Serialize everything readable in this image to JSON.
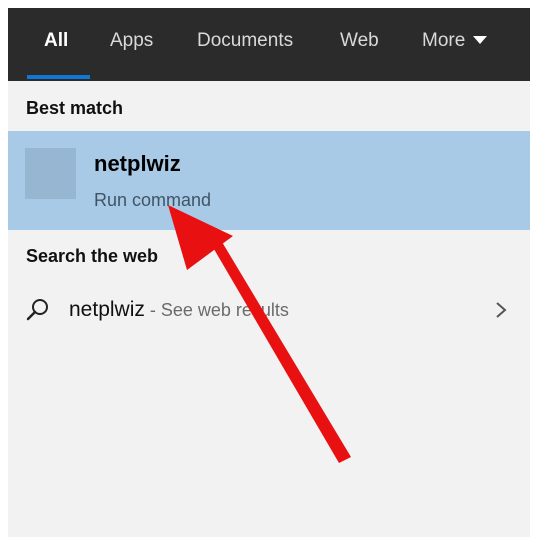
{
  "tabs": [
    {
      "label": "All",
      "active": true
    },
    {
      "label": "Apps"
    },
    {
      "label": "Documents"
    },
    {
      "label": "Web"
    },
    {
      "label": "More"
    }
  ],
  "best_match": {
    "heading": "Best match",
    "title": "netplwiz",
    "subtitle": "Run command"
  },
  "search_web": {
    "heading": "Search the web",
    "term": "netplwiz",
    "suffix": " - See web results",
    "icon": "search-icon",
    "chevron": "chevron-right-icon"
  },
  "colors": {
    "tabbar_bg": "#2b2b2b",
    "accent": "#0f78d4",
    "selected_row_bg": "#a9cae6",
    "annotation_arrow": "#e81010"
  }
}
